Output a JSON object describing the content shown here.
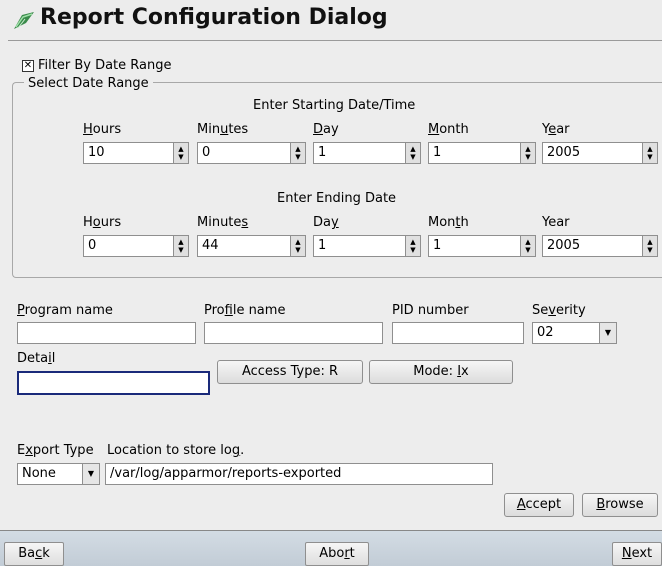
{
  "title": "Report Configuration Dialog",
  "filter": {
    "label": "Filter By Date Range",
    "checked": true
  },
  "date_group": {
    "legend": "Select Date Range",
    "start_heading": "Enter Starting Date/Time",
    "end_heading": "Enter Ending Date",
    "start_labels": {
      "hours": "Hours",
      "minutes": "Minutes",
      "day": "Day",
      "month": "Month",
      "year": "Year"
    },
    "end_labels": {
      "hours": "Hours",
      "minutes": "Minutes",
      "day": "Day",
      "month": "Month",
      "year": "Year"
    },
    "start_values": {
      "hours": "10",
      "minutes": "0",
      "day": "1",
      "month": "1",
      "year": "2005"
    },
    "end_values": {
      "hours": "0",
      "minutes": "44",
      "day": "1",
      "month": "1",
      "year": "2005"
    }
  },
  "filters": {
    "program_label": "Program name",
    "program_value": "",
    "profile_label": "Profile name",
    "profile_value": "",
    "pid_label": "PID number",
    "pid_value": "",
    "severity_label": "Severity",
    "severity_value": "02",
    "detail_label": "Detail",
    "detail_value": "",
    "access_button": "Access Type: R",
    "mode_button": "Mode: Ix"
  },
  "export": {
    "type_label": "Export Type",
    "type_value": "None",
    "location_label": "Location to store log.",
    "location_value": "/var/log/apparmor/reports-exported",
    "accept_label": "Accept",
    "browse_label": "Browse"
  },
  "nav": {
    "back": "Back",
    "abort": "Abort",
    "next": "Next"
  },
  "colors": {
    "focus_border": "#1a2a7a",
    "bottom_bar": "#c8d2dc"
  }
}
